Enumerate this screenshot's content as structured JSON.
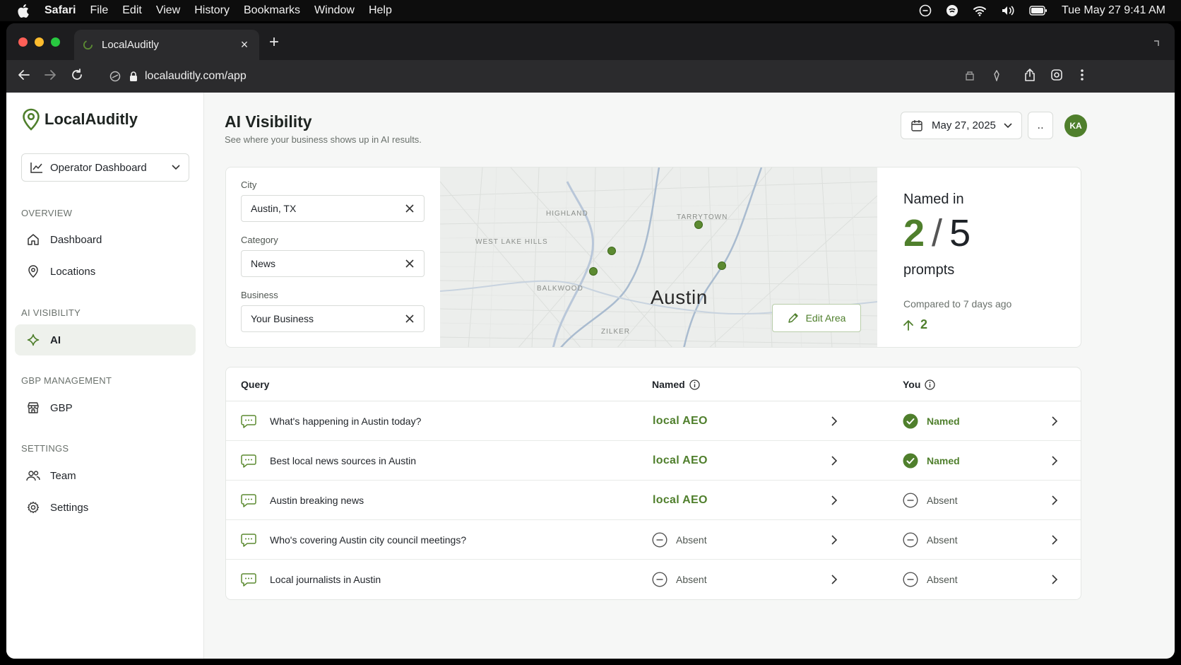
{
  "menubar": {
    "app": "Safari",
    "items": [
      "File",
      "Edit",
      "View",
      "History",
      "Bookmarks",
      "Window",
      "Help"
    ],
    "clock": "Tue May 27  9:41 AM"
  },
  "browser": {
    "tab_title": "LocalAuditly",
    "url": "localauditly.com/app"
  },
  "sidebar": {
    "brand": "LocalAuditly",
    "dashboard_select": "Operator Dashboard",
    "sections": {
      "overview": "OVERVIEW",
      "ai_visibility": "AI VISIBILITY",
      "gbp": "GBP MANAGEMENT",
      "settings": "SETTINGS"
    },
    "items": {
      "dashboard": "Dashboard",
      "locations": "Locations",
      "ai": "AI",
      "gbp": "GBP",
      "team": "Team",
      "settings": "Settings"
    }
  },
  "header": {
    "title": "AI Visibility",
    "subtitle": "See where your business shows up in AI results.",
    "date": "May 27, 2025",
    "more": "‥",
    "avatar": "KA"
  },
  "filters": {
    "city_label": "City",
    "city_value": "Austin, TX",
    "category_label": "Category",
    "category_value": "News",
    "business_label": "Business",
    "business_value": "Your Business"
  },
  "map": {
    "city": "Austin",
    "labels": [
      "BALKWOOD",
      "ZILKER",
      "HIGHLAND",
      "TARRYTOWN",
      "WEST LAKE HILLS"
    ],
    "edit_button": "Edit Area"
  },
  "stats": {
    "named_in": "Named in",
    "count": "2",
    "separator": "/",
    "total": "5",
    "prompts": "prompts",
    "compared": "Compared to 7 days ago",
    "delta": "2"
  },
  "table": {
    "headers": {
      "query": "Query",
      "named": "Named",
      "you": "You"
    },
    "rows": [
      {
        "query": "What's happening in Austin today?",
        "named": "local AEO",
        "you": "Named"
      },
      {
        "query": "Best local news sources in Austin",
        "named": "local AEO",
        "you": "Named"
      },
      {
        "query": "Austin breaking news",
        "named": "local AEO",
        "you": "Absent"
      },
      {
        "query": "Who's covering Austin city council meetings?",
        "named": "Absent",
        "you": "Absent"
      },
      {
        "query": "Local journalists in Austin",
        "named": "Absent",
        "you": "Absent"
      }
    ]
  },
  "colors": {
    "accent": "#4f7f2c",
    "background": "#f6f7f6"
  }
}
